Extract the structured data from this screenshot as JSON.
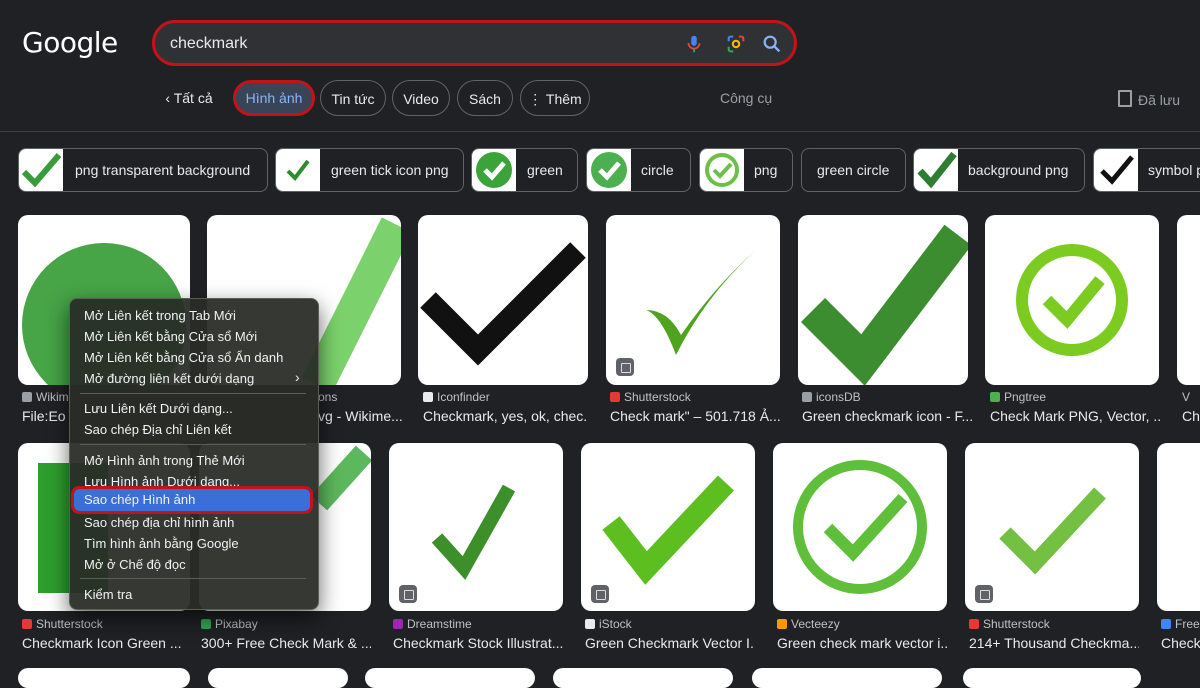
{
  "header": {
    "logo": "Google",
    "search_value": "checkmark",
    "icons": [
      "mic-icon",
      "lens-icon",
      "search-icon"
    ]
  },
  "tabs": {
    "all": "Tất cả",
    "images": "Hình ảnh",
    "news": "Tin tức",
    "video": "Video",
    "books": "Sách",
    "more": "Thêm",
    "tools": "Công cụ",
    "saved": "Đã lưu"
  },
  "chips": [
    {
      "label": "png transparent background"
    },
    {
      "label": "green tick icon png"
    },
    {
      "label": "green"
    },
    {
      "label": "circle"
    },
    {
      "label": "png"
    },
    {
      "label": "green circle"
    },
    {
      "label": "background png"
    },
    {
      "label": "symbol p"
    }
  ],
  "row1": [
    {
      "source": "Wikim",
      "title": "File:Eo c"
    },
    {
      "source": "ons",
      "title": "vg - Wikime..."
    },
    {
      "source": "Iconfinder",
      "title": "Checkmark, yes, ok, chec..."
    },
    {
      "source": "Shutterstock",
      "title": "Check mark\" – 501.718 Ả..."
    },
    {
      "source": "iconsDB",
      "title": "Green checkmark icon - F..."
    },
    {
      "source": "Pngtree",
      "title": "Check Mark PNG, Vector, ..."
    },
    {
      "source": "V",
      "title": "Che"
    }
  ],
  "row2": [
    {
      "source": "Shutterstock",
      "title": "Checkmark Icon Green ..."
    },
    {
      "source": "Pixabay",
      "title": "300+ Free Check Mark & ..."
    },
    {
      "source": "Dreamstime",
      "title": "Checkmark Stock Illustrat..."
    },
    {
      "source": "iStock",
      "title": "Green Checkmark Vector I..."
    },
    {
      "source": "Vecteezy",
      "title": "Green check mark vector i..."
    },
    {
      "source": "Shutterstock",
      "title": "214+ Thousand Checkma..."
    },
    {
      "source": "Free",
      "title": "Check"
    }
  ],
  "context_menu": [
    "Mở Liên kết trong Tab Mới",
    "Mở Liên kết bằng Cửa sổ Mới",
    "Mở Liên kết bằng Cửa sổ Ẩn danh",
    "Mở đường liên kết dưới dạng",
    "Lưu Liên kết Dưới dạng...",
    "Sao chép Địa chỉ Liên kết",
    "Mở Hình ảnh trong Thẻ Mới",
    "Lưu Hình ảnh Dưới dạng...",
    "Sao chép Hình ảnh",
    "Sao chép địa chỉ hình ảnh",
    "Tìm hình ảnh bằng Google",
    "Mở ở Chế độ đọc",
    "Kiểm tra"
  ],
  "colors": {
    "accent_red": "#c4121b",
    "check_green": "#4caf50",
    "highlight_blue": "#3a6fd8"
  }
}
